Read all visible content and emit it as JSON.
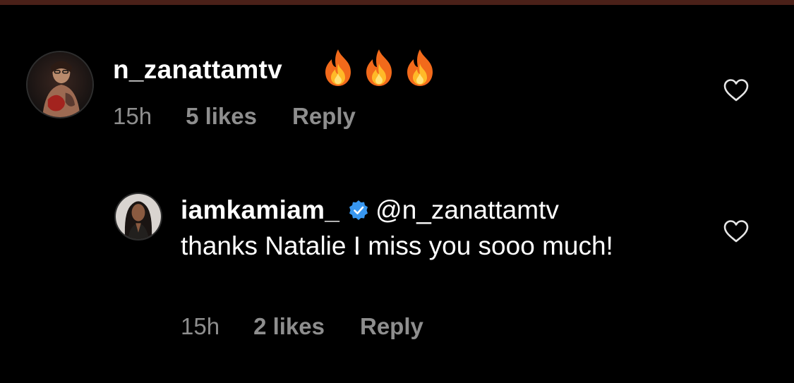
{
  "comments": [
    {
      "username": "n_zanattamtv",
      "emoji": [
        "fire",
        "fire",
        "fire"
      ],
      "time": "15h",
      "likes": "5 likes",
      "reply_label": "Reply",
      "like_icon": "heart-outline-icon",
      "avatar": "user-avatar"
    }
  ],
  "reply": {
    "username": "iamkamiam_",
    "verified": true,
    "verified_color": "#3897f0",
    "mention": "@n_zanattamtv",
    "text": "thanks Natalie I miss you sooo much!",
    "time": "15h",
    "likes": "2 likes",
    "reply_label": "Reply",
    "like_icon": "heart-outline-icon",
    "avatar": "user-avatar"
  },
  "colors": {
    "background": "#000000",
    "text": "#ffffff",
    "meta": "#8e8e8e",
    "top_bar": "#4a2018"
  }
}
